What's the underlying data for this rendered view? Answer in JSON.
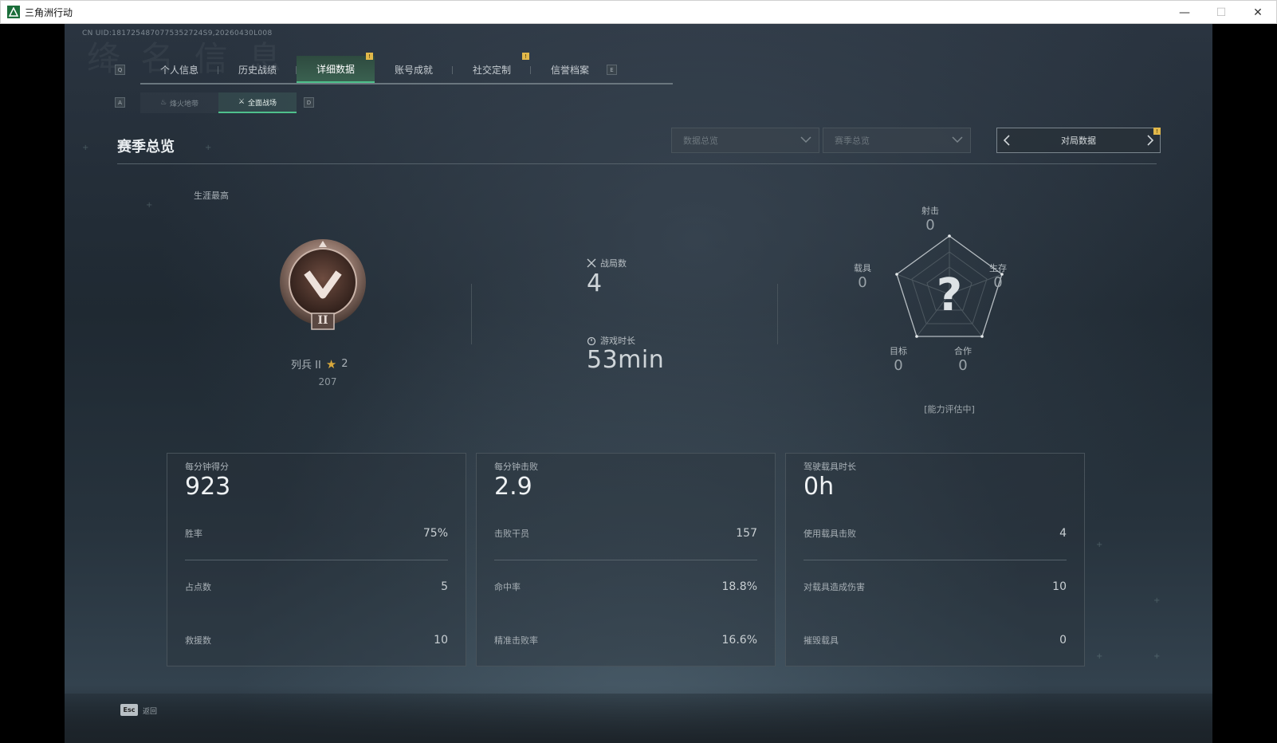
{
  "window": {
    "title": "三角洲行动",
    "minimize": "—",
    "maximize": "☐",
    "close": "✕"
  },
  "background_text": "绛 名 信 息",
  "uid": "CN UID:1817254870775352724S9,20260430L008",
  "keys": {
    "left": "Q",
    "right": "E",
    "sub_left": "A",
    "sub_right": "D"
  },
  "tabs": [
    {
      "label": "个人信息",
      "active": false
    },
    {
      "label": "历史战绩",
      "active": false
    },
    {
      "label": "详细数据",
      "active": true,
      "mark": "!"
    },
    {
      "label": "账号成就",
      "active": false
    },
    {
      "label": "社交定制",
      "active": false,
      "mark": "!"
    },
    {
      "label": "信誉档案",
      "active": false
    }
  ],
  "subtabs": [
    {
      "label": "烽火地带",
      "icon": "♨",
      "active": false
    },
    {
      "label": "全面战场",
      "icon": "⚔",
      "active": true
    }
  ],
  "section": {
    "title": "赛季总览",
    "dropdown1": "数据总览",
    "dropdown2": "赛季总览",
    "pager_label": "对局数据",
    "pager_mark": "!"
  },
  "career": {
    "label": "生涯最高",
    "rank_name": "列兵 II",
    "stars": "2",
    "points": "207",
    "rank_numeral": "II"
  },
  "stats": {
    "matches_label": "战局数",
    "matches_value": "4",
    "playtime_label": "游戏时长",
    "playtime_value": "53min"
  },
  "radar": {
    "shooting_label": "射击",
    "shooting_value": "0",
    "survival_label": "生存",
    "survival_value": "0",
    "cooperation_label": "合作",
    "cooperation_value": "0",
    "objective_label": "目标",
    "objective_value": "0",
    "vehicle_label": "载具",
    "vehicle_value": "0",
    "center_symbol": "?",
    "note": "[能力评估中]"
  },
  "cards": [
    {
      "caption": "每分钟得分",
      "value": "923",
      "rows": [
        {
          "k": "胜率",
          "v": "75%"
        },
        {
          "k": "占点数",
          "v": "5"
        },
        {
          "k": "救援数",
          "v": "10"
        }
      ]
    },
    {
      "caption": "每分钟击败",
      "value": "2.9",
      "rows": [
        {
          "k": "击败干员",
          "v": "157"
        },
        {
          "k": "命中率",
          "v": "18.8%"
        },
        {
          "k": "精准击败率",
          "v": "16.6%"
        }
      ]
    },
    {
      "caption": "驾驶载具时长",
      "value": "0h",
      "rows": [
        {
          "k": "使用载具击败",
          "v": "4"
        },
        {
          "k": "对载具造成伤害",
          "v": "10"
        },
        {
          "k": "摧毁载具",
          "v": "0"
        }
      ]
    }
  ],
  "footer": {
    "esc_key": "Esc",
    "back_label": "返回"
  }
}
